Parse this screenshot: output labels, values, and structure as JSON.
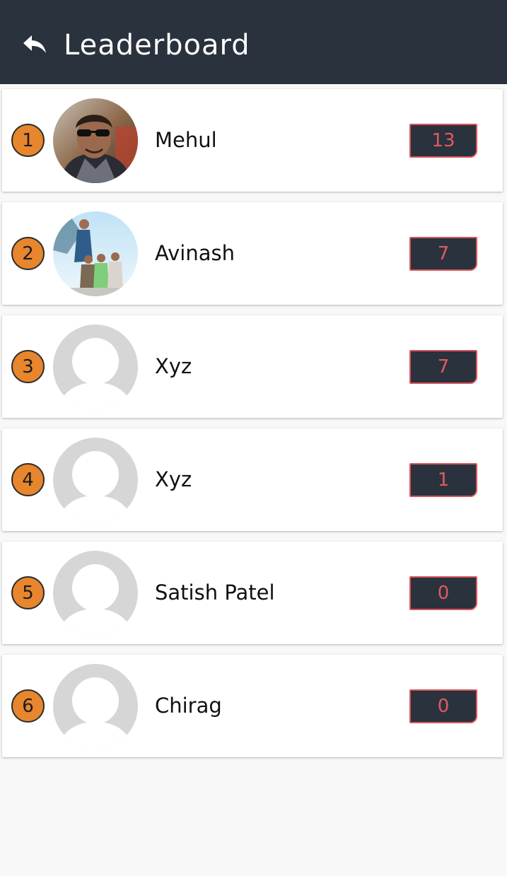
{
  "header": {
    "title": "Leaderboard",
    "back_icon": "back-arrow-icon",
    "background": "#2a323e"
  },
  "colors": {
    "rank_badge": "#e8862d",
    "score_box": "#2a323e",
    "score_border": "#d9545a",
    "score_text": "#e25a5f"
  },
  "entries": [
    {
      "rank": "1",
      "name": "Mehul",
      "score": "13",
      "avatar": "photo-avatar-1"
    },
    {
      "rank": "2",
      "name": "Avinash",
      "score": "7",
      "avatar": "photo-avatar-2"
    },
    {
      "rank": "3",
      "name": "Xyz",
      "score": "7",
      "avatar": "default-avatar"
    },
    {
      "rank": "4",
      "name": "Xyz",
      "score": "1",
      "avatar": "default-avatar"
    },
    {
      "rank": "5",
      "name": "Satish Patel",
      "score": "0",
      "avatar": "default-avatar"
    },
    {
      "rank": "6",
      "name": "Chirag",
      "score": "0",
      "avatar": "default-avatar"
    }
  ]
}
